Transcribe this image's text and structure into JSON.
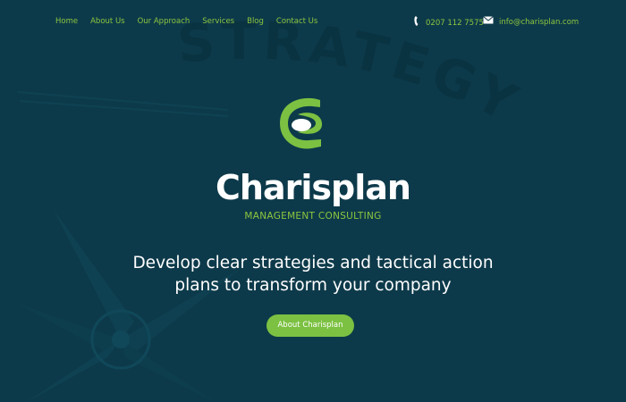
{
  "nav": {
    "items": [
      {
        "label": "Home"
      },
      {
        "label": "About Us"
      },
      {
        "label": "Our Approach"
      },
      {
        "label": "Services"
      },
      {
        "label": "Blog"
      },
      {
        "label": "Contact Us"
      }
    ]
  },
  "contact": {
    "phone": "0207 112 7575",
    "email": "info@charisplan.com",
    "phone_icon": "phone-icon",
    "email_icon": "envelope-icon"
  },
  "hero": {
    "brand": "Charisplan",
    "tagline": "MANAGEMENT CONSULTING",
    "headline_line1": "Develop clear strategies and tactical action",
    "headline_line2": "plans to transform your company",
    "cta_label": "About Charisplan",
    "background_text": "STRATEGY"
  },
  "colors": {
    "background": "#0d3a4a",
    "accent": "#8cc63f",
    "button": "#7cc142",
    "text": "#ffffff"
  }
}
